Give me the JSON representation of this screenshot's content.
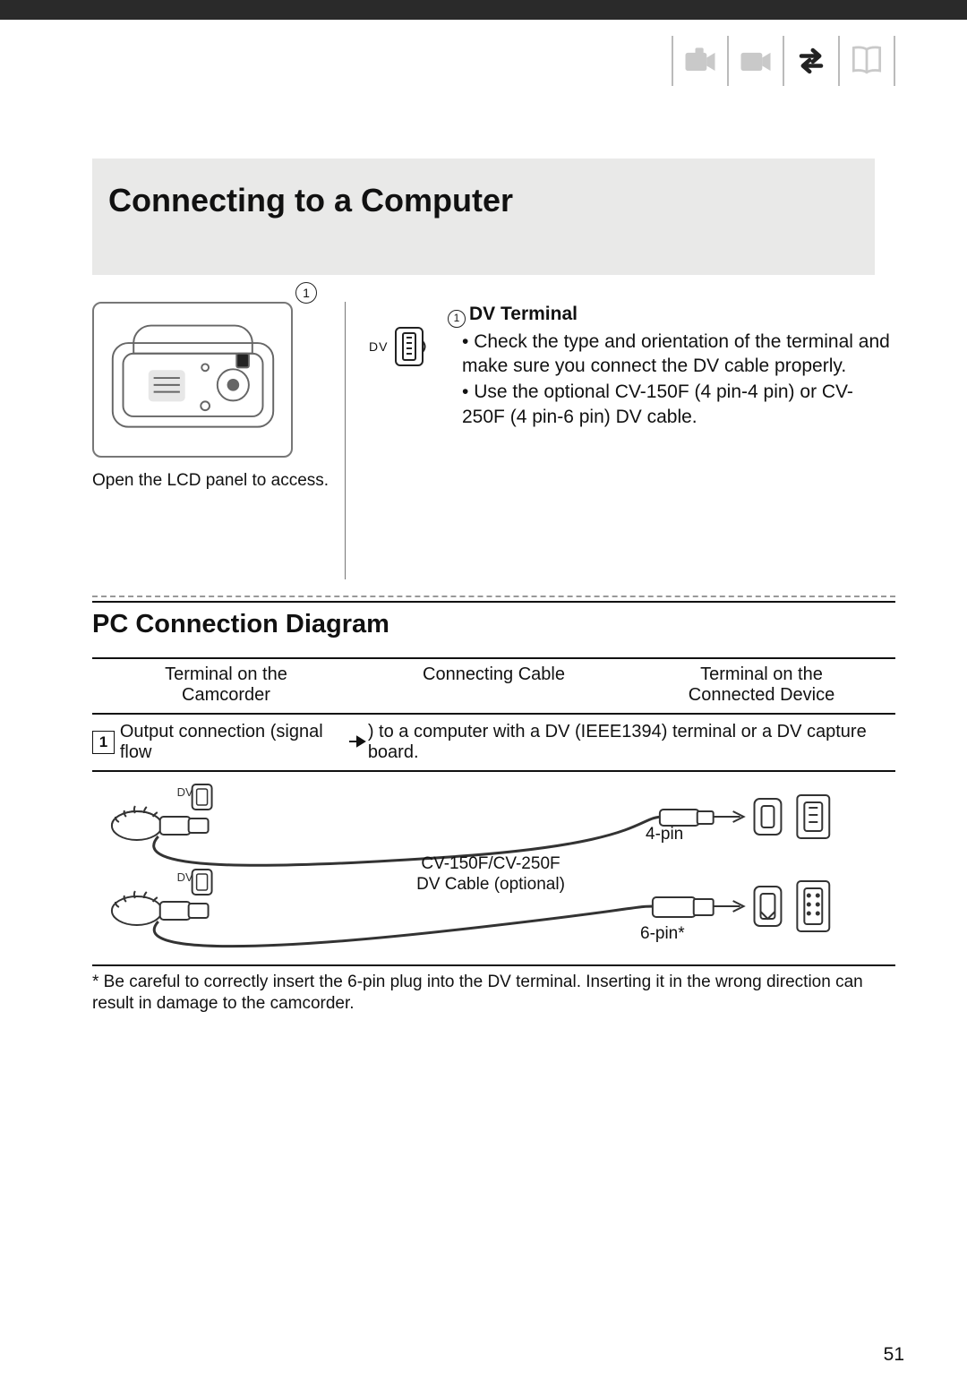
{
  "page_number": "51",
  "title": "Connecting to a Computer",
  "mode_icons": [
    {
      "name": "camera-mode-icon",
      "active": false
    },
    {
      "name": "play-mode-icon",
      "active": false
    },
    {
      "name": "transfer-mode-icon",
      "active": true
    },
    {
      "name": "manual-book-icon",
      "active": false
    }
  ],
  "terminal": {
    "callout_number": "1",
    "dv_label": "DV",
    "heading_prefix": "①",
    "heading": "DV Terminal",
    "bullets": [
      "Check the type and orientation of the terminal and make sure you connect the DV cable properly.",
      "Use the optional CV-150F (4 pin-4 pin) or CV-250F (4 pin-6 pin) DV cable."
    ],
    "lcd_caption": "Open the LCD panel to access."
  },
  "diagram": {
    "section_title": "PC Connection Diagram",
    "columns": {
      "left": "Terminal on the\nCamcorder",
      "mid": "Connecting Cable",
      "right": "Terminal on the\nConnected Device"
    },
    "row_number": "1",
    "row_desc_before": "Output connection (signal flow ",
    "row_desc_after": " ) to a computer with a DV (IEEE1394) terminal or a DV capture board.",
    "dv_port_label": "DV",
    "cable_label_line1": "CV-150F/CV-250F",
    "cable_label_line2": "DV Cable (optional)",
    "pin4_label": "4-pin",
    "pin6_label": "6-pin*",
    "footnote": "*  Be careful to correctly insert the 6-pin plug into the DV terminal. Inserting it in the wrong direction can result in damage to the camcorder."
  },
  "chart_data": {
    "type": "table",
    "title": "PC Connection Diagram",
    "columns": [
      "Terminal on the Camcorder",
      "Connecting Cable",
      "Terminal on the Connected Device"
    ],
    "rows": [
      {
        "row": 1,
        "description": "Output connection (signal flow →) to a computer with a DV (IEEE1394) terminal or a DV capture board.",
        "camcorder_terminal": "DV",
        "cable": "CV-150F/CV-250F DV Cable (optional)",
        "device_terminals": [
          "4-pin",
          "6-pin*"
        ]
      }
    ],
    "footnote": "* Be careful to correctly insert the 6-pin plug into the DV terminal. Inserting it in the wrong direction can result in damage to the camcorder."
  }
}
